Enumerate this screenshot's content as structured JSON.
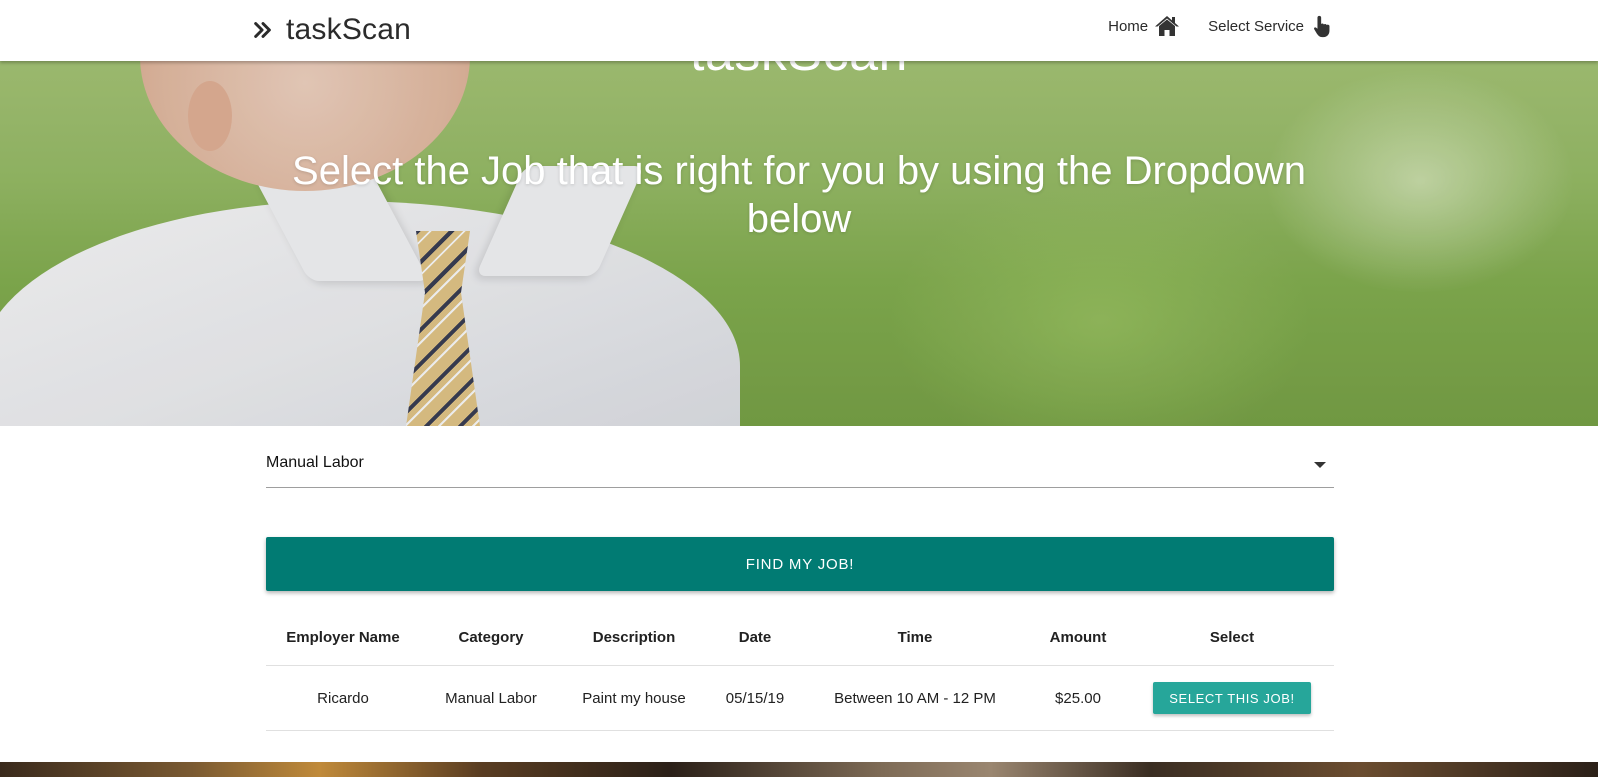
{
  "brand": {
    "name": "taskScan",
    "icon": "double-chevron-right-icon"
  },
  "nav": {
    "home_label": "Home",
    "home_icon": "home-icon",
    "service_label": "Select Service",
    "service_icon": "hand-pointer-icon"
  },
  "hero": {
    "title": "taskScan",
    "subtitle": "Select the Job that is right for you by using the Dropdown below"
  },
  "job_select": {
    "selected": "Manual Labor"
  },
  "find_button": {
    "label": "FIND MY JOB!"
  },
  "table": {
    "headers": [
      "Employer Name",
      "Category",
      "Description",
      "Date",
      "Time",
      "Amount",
      "Select"
    ],
    "rows": [
      {
        "employer": "Ricardo",
        "category": "Manual Labor",
        "description": "Paint my house",
        "date": "05/15/19",
        "time": "Between 10 AM - 12 PM",
        "amount": "$25.00",
        "select_label": "SELECT THIS JOB!"
      }
    ]
  },
  "colors": {
    "primary": "#017b73",
    "accent": "#26a69a",
    "navbar_bg": "#ffffff"
  }
}
